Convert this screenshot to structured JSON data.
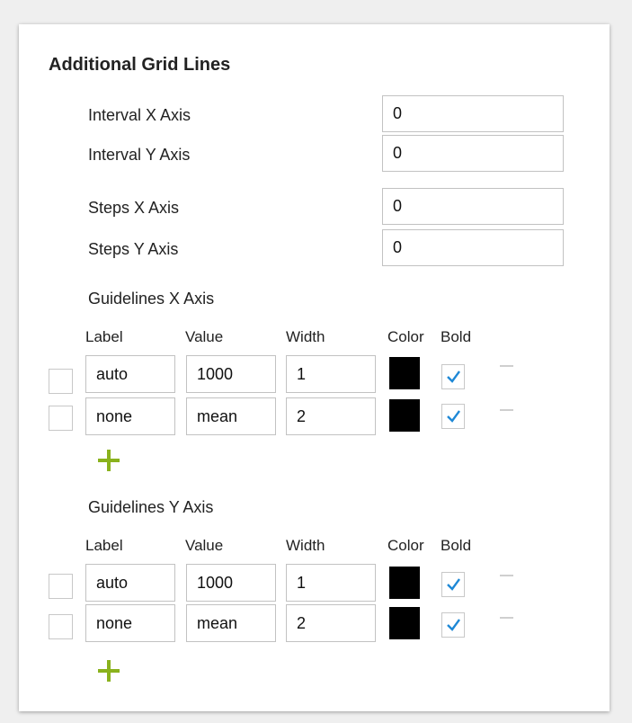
{
  "section": {
    "title": "Additional Grid Lines"
  },
  "intervals": [
    {
      "label": "Interval X Axis",
      "value": "0"
    },
    {
      "label": "Interval Y Axis",
      "value": "0"
    }
  ],
  "steps": [
    {
      "label": "Steps X Axis",
      "value": "0"
    },
    {
      "label": "Steps Y Axis",
      "value": "0"
    }
  ],
  "columns": {
    "label": "Label",
    "value": "Value",
    "width": "Width",
    "color": "Color",
    "bold": "Bold"
  },
  "guidelines_x": {
    "title": "Guidelines X Axis",
    "rows": [
      {
        "label": "auto",
        "value": "1000",
        "width": "1",
        "color": "#000000",
        "bold": true
      },
      {
        "label": "none",
        "value": "mean",
        "width": "2",
        "color": "#000000",
        "bold": true
      }
    ]
  },
  "guidelines_y": {
    "title": "Guidelines Y Axis",
    "rows": [
      {
        "label": "auto",
        "value": "1000",
        "width": "1",
        "color": "#000000",
        "bold": true
      },
      {
        "label": "none",
        "value": "mean",
        "width": "2",
        "color": "#000000",
        "bold": true
      }
    ]
  },
  "colors": {
    "accent_plus": "#8ab21d",
    "check": "#1e88d6",
    "panel_bg": "#ffffff",
    "page_bg": "#efefef"
  },
  "icons": {
    "add": "plus-icon",
    "remove": "minus-icon",
    "check": "checkmark-icon"
  }
}
